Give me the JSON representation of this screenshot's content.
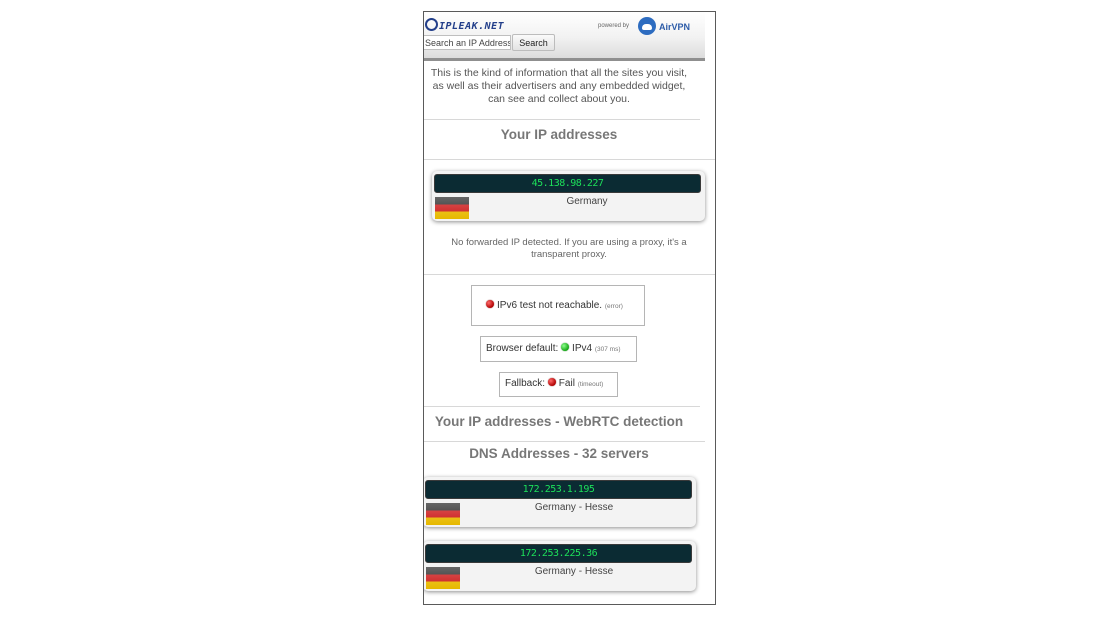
{
  "header": {
    "logo_text": "IPLEAK.NET",
    "powered_by": "powered by",
    "sponsor": "AirVPN",
    "search_placeholder": "Search an IP Address",
    "search_button": "Search"
  },
  "intro": "This is the kind of information that all the sites you visit, as well as their advertisers and any embedded widget, can see and collect about you.",
  "ip_section": {
    "title": "Your IP addresses",
    "ip": "45.138.98.227",
    "country": "Germany",
    "forwarded_note": "No forwarded IP detected. If you are using a proxy, it's a transparent proxy."
  },
  "ipv6": {
    "label": "IPv6 test not reachable.",
    "detail": "(error)",
    "status_color": "#cc0000"
  },
  "browser_default": {
    "label": "Browser default:",
    "value": "IPv4",
    "detail": "(307 ms)",
    "status_color": "#17b017"
  },
  "fallback": {
    "label": "Fallback:",
    "value": "Fail",
    "detail": "(timeout)",
    "status_color": "#cc0000"
  },
  "webrtc": {
    "title": "Your IP addresses - WebRTC detection"
  },
  "dns": {
    "title": "DNS Addresses - 32 servers",
    "servers": [
      {
        "ip": "172.253.1.195",
        "location": "Germany - Hesse"
      },
      {
        "ip": "172.253.225.36",
        "location": "Germany - Hesse"
      }
    ]
  },
  "colors": {
    "ip_bar_bg": "#0b2b33",
    "ip_bar_text": "#1de05a",
    "brand_blue": "#233f8a"
  }
}
